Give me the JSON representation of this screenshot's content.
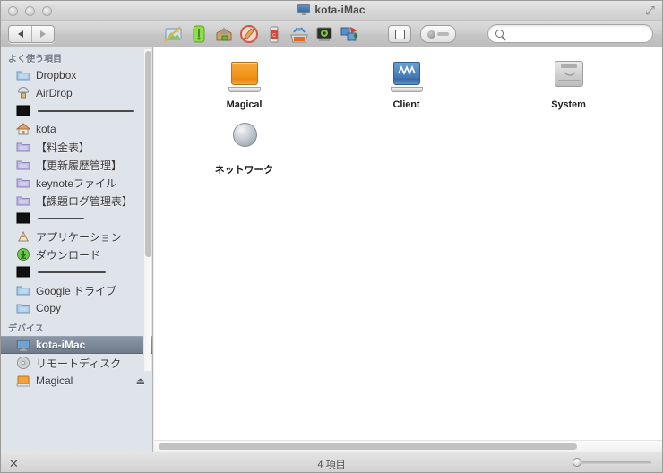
{
  "window": {
    "title": "kota-iMac",
    "title_icon": "imac-display-icon",
    "fullscreen_icon": "⤢"
  },
  "toolbar": {
    "back_label": "◀",
    "forward_label": "▶",
    "app_icons": [
      {
        "name": "preview-app-icon"
      },
      {
        "name": "green-drive-app-icon"
      },
      {
        "name": "unarchiver-app-icon"
      },
      {
        "name": "disk-burn-app-icon"
      },
      {
        "name": "cleaner-can-icon"
      },
      {
        "name": "scanner-app-icon"
      },
      {
        "name": "video-app-icon"
      },
      {
        "name": "network-tool-icon"
      }
    ],
    "view_toggle_name": "view-mode-button",
    "action_button_name": "action-toggle-button",
    "search_placeholder": "",
    "search_value": ""
  },
  "sidebar": {
    "groups": [
      {
        "title": "よく使う項目",
        "items": [
          {
            "label": "Dropbox",
            "icon": "dropbox-folder-icon",
            "type": "folder-blue"
          },
          {
            "label": "AirDrop",
            "icon": "airdrop-icon",
            "type": "airdrop"
          },
          {
            "label": "",
            "icon": "black-square-icon",
            "type": "sep-long"
          },
          {
            "label": "kota",
            "icon": "home-icon",
            "type": "home"
          },
          {
            "label": "【料金表】",
            "icon": "folder-icon",
            "type": "folder-purple"
          },
          {
            "label": "【更新履歴管理】",
            "icon": "folder-icon",
            "type": "folder-purple"
          },
          {
            "label": "keynoteファイル",
            "icon": "folder-icon",
            "type": "folder-purple"
          },
          {
            "label": "【課題ログ管理表】",
            "icon": "folder-icon",
            "type": "folder-purple"
          },
          {
            "label": "",
            "icon": "black-square-icon",
            "type": "sep-short"
          },
          {
            "label": "アプリケーション",
            "icon": "applications-icon",
            "type": "apps"
          },
          {
            "label": "ダウンロード",
            "icon": "downloads-icon",
            "type": "downloads"
          },
          {
            "label": "",
            "icon": "black-square-icon",
            "type": "sep-mid"
          },
          {
            "label": "Google ドライブ",
            "icon": "folder-icon",
            "type": "folder-blue"
          },
          {
            "label": "Copy",
            "icon": "folder-icon",
            "type": "folder-blue"
          }
        ]
      },
      {
        "title": "デバイス",
        "items": [
          {
            "label": "kota-iMac",
            "icon": "imac-display-icon",
            "type": "imac",
            "selected": true
          },
          {
            "label": "リモートディスク",
            "icon": "remote-disc-icon",
            "type": "disc"
          },
          {
            "label": "Magical",
            "icon": "external-drive-icon",
            "type": "drive-orange",
            "eject": "⏏"
          }
        ]
      }
    ]
  },
  "content": {
    "items": [
      {
        "label": "Magical",
        "icon": "external-drive-orange-icon",
        "kind": "drive-orange"
      },
      {
        "label": "Client",
        "icon": "network-drive-blue-icon",
        "kind": "drive-blue"
      },
      {
        "label": "System",
        "icon": "internal-hard-drive-icon",
        "kind": "drive-gray"
      },
      {
        "label": "ネットワーク",
        "icon": "network-globe-icon",
        "kind": "globe"
      }
    ]
  },
  "statusbar": {
    "item_count": "4 項目",
    "tool_icon": "x-tool-icon",
    "zoom_value": "0"
  },
  "colors": {
    "sidebar_bg": "#dfe3ea",
    "selection": "#6f7b8c",
    "content_bg": "#ffffff",
    "drive_orange": "#ef8f12",
    "drive_blue": "#3f77b4"
  }
}
